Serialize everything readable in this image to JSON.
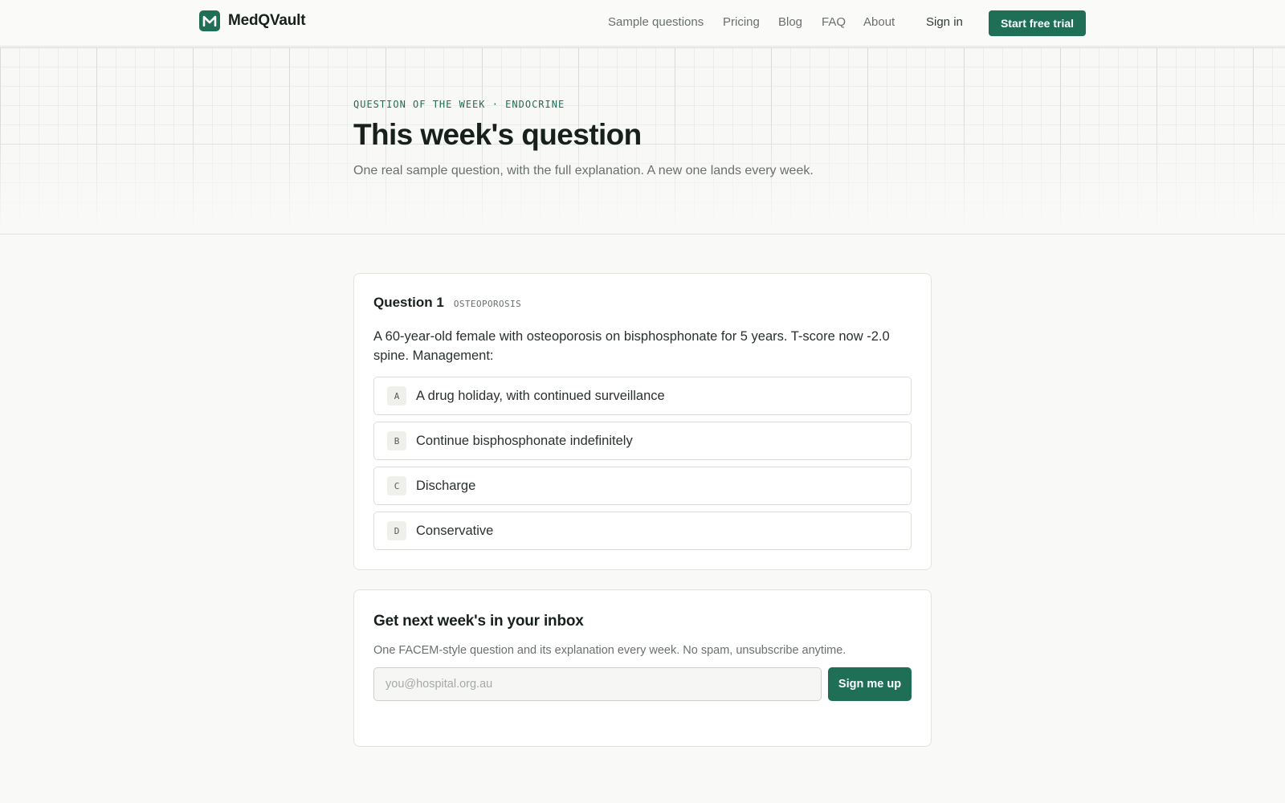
{
  "nav": {
    "brand": "MedQVault",
    "links": [
      "Sample questions",
      "Pricing",
      "Blog",
      "FAQ",
      "About"
    ],
    "sign_in": "Sign in",
    "cta": "Start free trial"
  },
  "hero": {
    "eyebrow": "QUESTION OF THE WEEK · ENDOCRINE",
    "title": "This week's question",
    "subtitle": "One real sample question, with the full explanation. A new one lands every week."
  },
  "question": {
    "number_label": "Question 1",
    "topic": "OSTEOPOROSIS",
    "stem": "A 60-year-old female with osteoporosis on bisphosphonate for 5 years. T-score now -2.0 spine. Management:",
    "options": [
      {
        "letter": "A",
        "text": "A drug holiday, with continued surveillance"
      },
      {
        "letter": "B",
        "text": "Continue bisphosphonate indefinitely"
      },
      {
        "letter": "C",
        "text": "Discharge"
      },
      {
        "letter": "D",
        "text": "Conservative"
      }
    ]
  },
  "signup": {
    "title": "Get next week's in your inbox",
    "subtitle": "One FACEM-style question and its explanation every week. No spam, unsubscribe anytime.",
    "email_placeholder": "you@hospital.org.au",
    "button": "Sign me up"
  },
  "colors": {
    "accent": "#1f6f57",
    "background": "#f9f9f7",
    "card": "#ffffff",
    "border": "#e3e3df"
  },
  "icons": {
    "logo": "logo-icon"
  }
}
